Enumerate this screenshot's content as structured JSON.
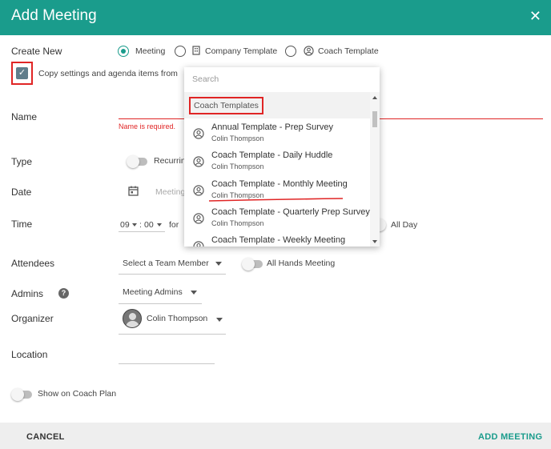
{
  "header": {
    "title": "Add Meeting",
    "close_icon": "close-icon"
  },
  "create_new": {
    "label": "Create New",
    "options": [
      "Meeting",
      "Company Template",
      "Coach Template"
    ],
    "selected": "Meeting"
  },
  "copy_settings": {
    "label": "Copy settings and agenda items from",
    "checked": true
  },
  "dropdown": {
    "search_placeholder": "Search",
    "group_label": "Coach Templates",
    "items": [
      {
        "title": "Annual Template - Prep Survey",
        "owner": "Colin Thompson"
      },
      {
        "title": "Coach Template - Daily Huddle",
        "owner": "Colin Thompson"
      },
      {
        "title": "Coach Template - Monthly Meeting",
        "owner": "Colin Thompson"
      },
      {
        "title": "Coach Template - Quarterly Prep Survey",
        "owner": "Colin Thompson"
      },
      {
        "title": "Coach Template - Weekly Meeting",
        "owner": ""
      }
    ]
  },
  "form": {
    "name_label": "Name",
    "name_error": "Name is required.",
    "type_label": "Type",
    "recurring_label": "Recurrin",
    "date_label": "Date",
    "date_placeholder": "Meeting",
    "time_label": "Time",
    "time_hour": "09",
    "time_colon": ":",
    "time_minute": "00",
    "for_label": "for",
    "all_day_label": "All Day",
    "attendees_label": "Attendees",
    "attendees_select": "Select a Team Member",
    "all_hands_label": "All Hands Meeting",
    "admins_label": "Admins",
    "admins_select": "Meeting Admins",
    "organizer_label": "Organizer",
    "organizer_name": "Colin Thompson",
    "location_label": "Location",
    "coach_plan_label": "Show on Coach Plan"
  },
  "footer": {
    "cancel_label": "CANCEL",
    "add_label": "ADD MEETING"
  },
  "colors": {
    "brand": "#1a9c8c",
    "error": "#e02525"
  }
}
